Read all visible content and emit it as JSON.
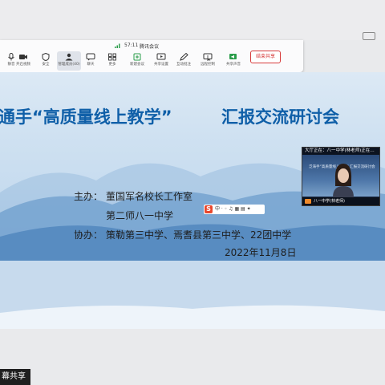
{
  "toolbar": {
    "time": "57:11",
    "meeting_name": "腾讯会议",
    "buttons": [
      {
        "label": "静音",
        "icon": "microphone-icon"
      },
      {
        "label": "开启视频",
        "icon": "video-camera-icon"
      },
      {
        "label": "安全",
        "icon": "shield-icon"
      },
      {
        "label": "管理成员(40)",
        "icon": "members-icon"
      },
      {
        "label": "聊天",
        "icon": "chat-icon"
      },
      {
        "label": "更多",
        "icon": "more-icon"
      },
      {
        "label": "新建会议",
        "icon": "plus-icon"
      },
      {
        "label": "共享设置",
        "icon": "share-settings-icon"
      },
      {
        "label": "互动批注",
        "icon": "annotate-icon"
      },
      {
        "label": "远程控制",
        "icon": "remote-control-icon"
      },
      {
        "label": "共享声音",
        "icon": "sound-icon"
      }
    ],
    "stop_share_label": "结束共享"
  },
  "slide": {
    "title_part1": "通手“高质量线上教学”",
    "title_part2": "汇报交流研讨会",
    "host_label": "主办：",
    "host_1": "董国军名校长工作室",
    "host_2": "第二师八一中学",
    "co_label": "协办：",
    "co_orgs": "策勒第三中学、焉耆县第三中学、22团中学",
    "date": "2022年11月8日"
  },
  "search_logo": {
    "letter": "S",
    "glyph": "中 · ◦ ♫ ▦ ▤ ✦"
  },
  "video": {
    "caption": "大厅正在：八一中学(林老师)正在…",
    "mini_title": "泛海手“高质量线上教学” 汇报交流研讨会",
    "participant_name": "八一中学(林老师)"
  },
  "share_tag": "幕共享",
  "colors": {
    "title": "#0f5fa8",
    "stop": "#d73b3b"
  }
}
